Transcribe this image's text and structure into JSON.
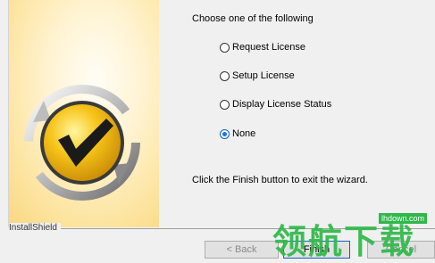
{
  "wizard": {
    "prompt": "Choose one of the following",
    "options": [
      {
        "label": "Request License",
        "checked": false
      },
      {
        "label": "Setup License",
        "checked": false
      },
      {
        "label": "Display License Status",
        "checked": false
      },
      {
        "label": "None",
        "checked": true
      }
    ],
    "finish_text": "Click the Finish button to exit the wizard.",
    "brand": "InstallShield"
  },
  "buttons": {
    "back": "< Back",
    "finish": "Finish",
    "cancel": "Cancel"
  },
  "watermark": {
    "text": "领航下载",
    "url": "lhdown.com"
  },
  "colors": {
    "accent": "#1a73e8",
    "logo_yellow": "#f7c51a",
    "watermark_green": "#2fb84a"
  }
}
